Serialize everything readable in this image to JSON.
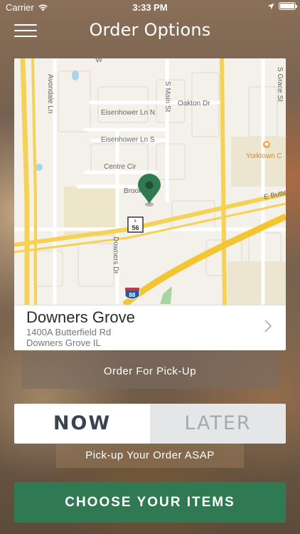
{
  "status": {
    "carrier": "Carrier",
    "time": "3:33 PM",
    "battery_level": 1.0
  },
  "nav": {
    "title": "Order Options"
  },
  "map": {
    "labels": {
      "avondale": "Avondale Ln",
      "main_st": "S Main St",
      "oakton": "Oakton Dr",
      "eisenhower_n": "Eisenhower Ln N",
      "eisenhower_s": "Eisenhower Ln S",
      "centre": "Centre Cir",
      "brook": "Brook",
      "butterfield": "E Butter",
      "downers_dr": "Downers Dr",
      "yorktown": "Yorktown C",
      "grace": "S Grace St",
      "route_state": "IL",
      "route_56": "56",
      "route_88": "88",
      "top_road": "W"
    }
  },
  "location": {
    "name": "Downers Grove",
    "address_line1": "1400A Butterfield Rd",
    "address_line2": "Downers Grove IL"
  },
  "order_type_label": "Order For Pick-Up",
  "timing": {
    "now": "NOW",
    "later": "LATER",
    "selected": "NOW"
  },
  "asap_label": "Pick-up Your Order ASAP",
  "cta_label": "CHOOSE YOUR ITEMS"
}
